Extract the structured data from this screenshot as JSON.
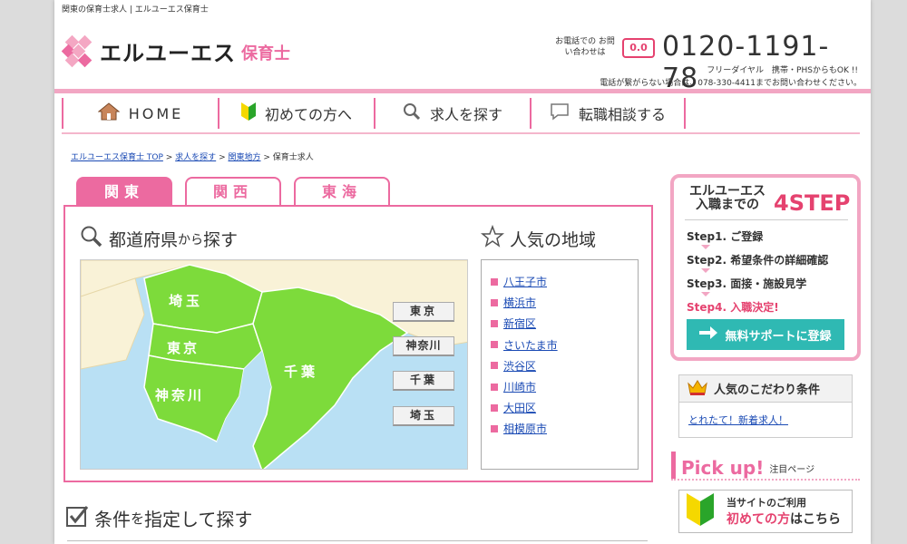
{
  "header": {
    "top_note": "関東の保育士求人 | エルユーエス保育士",
    "logo_name": "エルユーエス",
    "logo_sub": "保育士",
    "contact_label": "お電話での お問い合わせは",
    "freedial_icon": "0.0",
    "phone": "0120-1191-78",
    "phone_note": "フリーダイヤル　携帯・PHSからもOK !!",
    "alt_note": "電話が繋がらない場合は、078-330-4411までお問い合わせください。"
  },
  "nav": {
    "home": "HOME",
    "first": "初めての方へ",
    "search": "求人を探す",
    "consult": "転職相談する"
  },
  "breadcrumb": {
    "item1": "エルユーエス保育士 TOP",
    "item2": "求人を探す",
    "item3": "関東地方",
    "current": "保育士求人",
    "sep": ">"
  },
  "tabs": {
    "kanto": "関東",
    "kansai": "関西",
    "tokai": "東海"
  },
  "search_pref": {
    "title_a": "都道府県",
    "title_b": "から",
    "title_c": "探す"
  },
  "map": {
    "labels": {
      "saitama": "埼玉",
      "tokyo": "東京",
      "kanagawa": "神奈川",
      "chiba": "千葉"
    },
    "buttons": {
      "tokyo": "東京",
      "kanagawa": "神奈川",
      "chiba": "千葉",
      "saitama": "埼玉"
    },
    "colors": {
      "land": "#7ddb3b",
      "sea": "#b9e0f4",
      "other_land": "#f9f2d7"
    }
  },
  "popular": {
    "title": "人気の地域",
    "items": [
      "八王子市",
      "横浜市",
      "新宿区",
      "さいたま市",
      "渋谷区",
      "川崎市",
      "大田区",
      "相模原市"
    ]
  },
  "conditions": {
    "title_a": "条件",
    "title_b": "を",
    "title_c": "指定して探す"
  },
  "step": {
    "title1": "エルユーエス",
    "title2": "入職までの",
    "big": "4STEP",
    "s1": "Step1. ご登録",
    "s2": "Step2. 希望条件の詳細確認",
    "s3": "Step3. 面接・施設見学",
    "s4": "Step4. 入職決定!",
    "button": "無料サポートに登録"
  },
  "popular_conditions": {
    "title": "人気のこだわり条件",
    "link": "とれたて！新着求人！"
  },
  "pickup": {
    "title": "Pick up!",
    "sub": "注目ページ"
  },
  "first_banner": {
    "line1": "当サイトのご利用",
    "line2_a": "初めての方",
    "line2_b": "はこちら"
  },
  "colors": {
    "accent": "#ec6aa0",
    "teal": "#2fb9b3",
    "red": "#e5426f"
  }
}
